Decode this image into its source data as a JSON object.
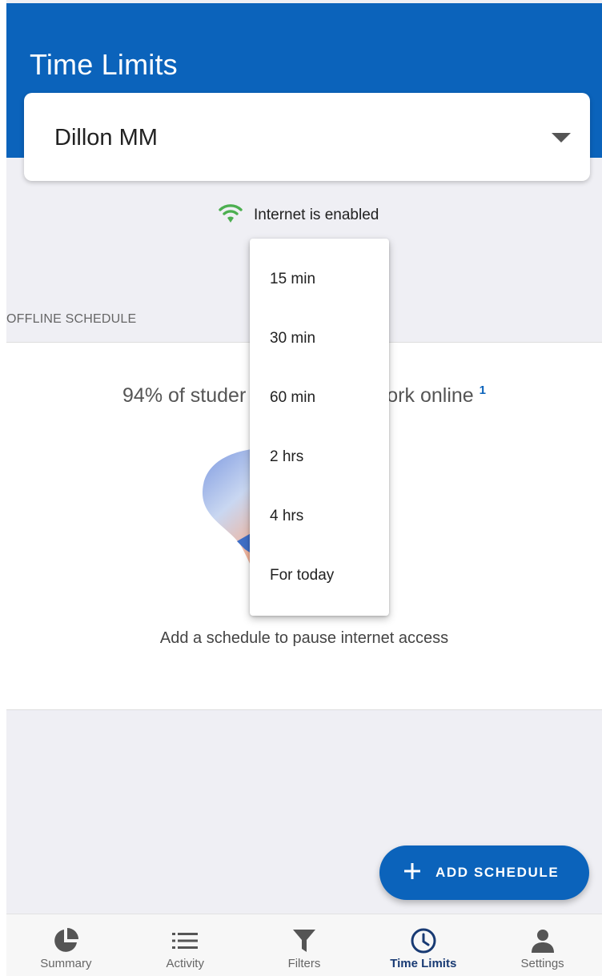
{
  "header": {
    "title": "Time Limits"
  },
  "device_select": {
    "selected": "Dillon MM"
  },
  "status": {
    "text": "Internet is enabled",
    "color": "#4caf50"
  },
  "section": {
    "label": "OFFLINE SCHEDULE"
  },
  "card": {
    "stat_visible_left": "94% of studer",
    "stat_visible_right": "ork online",
    "footnote": "1",
    "caption": "Add a schedule to pause internet access"
  },
  "dropdown": {
    "options": [
      "15 min",
      "30 min",
      "60 min",
      "2 hrs",
      "4 hrs",
      "For today"
    ]
  },
  "fab": {
    "label": "ADD SCHEDULE",
    "icon": "plus-icon"
  },
  "nav": {
    "items": [
      {
        "label": "Summary",
        "icon": "pie-chart-icon"
      },
      {
        "label": "Activity",
        "icon": "list-icon"
      },
      {
        "label": "Filters",
        "icon": "filter-icon"
      },
      {
        "label": "Time Limits",
        "icon": "clock-icon",
        "active": true
      },
      {
        "label": "Settings",
        "icon": "person-icon"
      }
    ]
  },
  "colors": {
    "primary": "#0b63bb",
    "active_nav": "#183a73",
    "background": "#efeff4",
    "wifi": "#4caf50"
  }
}
